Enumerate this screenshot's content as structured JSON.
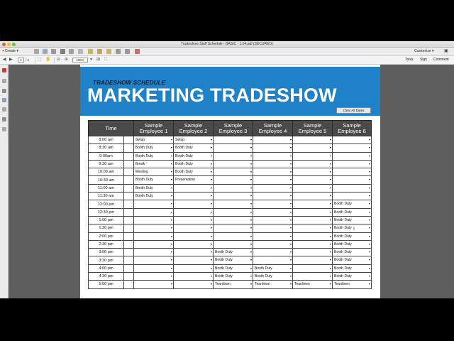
{
  "window": {
    "title": "Tradeshow Staff Schedule - BASIC - 1.04.pdf (SECURED)"
  },
  "toolbar": {
    "create_label": "Create",
    "customize_label": "Customize",
    "page_current": "1",
    "page_total": "/ 2",
    "zoom": "105%",
    "tools_label": "Tools",
    "sign_label": "Sign",
    "comment_label": "Comment"
  },
  "document": {
    "subtitle": "TRADESHOW SCHEDULE",
    "title": "MARKETING TRADESHOW",
    "clear_button": "Clear All Dates",
    "table": {
      "time_header": "Time",
      "employee_headers": [
        "Sample Employee 1",
        "Sample Employee 2",
        "Sample Employee 3",
        "Sample Employee 4",
        "Sample Employee 5",
        "Sample Employee 6"
      ],
      "rows": [
        {
          "time": "8:00 am",
          "cells": [
            "Setup",
            "Setup",
            "",
            "",
            "",
            ""
          ]
        },
        {
          "time": "8:30 am",
          "cells": [
            "Booth Duty",
            "Booth Duty",
            "",
            "",
            "",
            ""
          ]
        },
        {
          "time": "9:00am",
          "cells": [
            "Booth Duty",
            "Booth Duty",
            "",
            "",
            "",
            ""
          ]
        },
        {
          "time": "9:30 am",
          "cells": [
            "Break",
            "Booth Duty",
            "",
            "",
            "",
            ""
          ]
        },
        {
          "time": "10:00 am",
          "cells": [
            "Meeting",
            "Booth Duty",
            "",
            "",
            "",
            ""
          ]
        },
        {
          "time": "10:30 am",
          "cells": [
            "Booth Duty",
            "Presentation",
            "",
            "",
            "",
            ""
          ]
        },
        {
          "time": "11:00 am",
          "cells": [
            "Booth Duty",
            "",
            "",
            "",
            "",
            ""
          ]
        },
        {
          "time": "11:30 am",
          "cells": [
            "Booth Duty",
            "",
            "",
            "",
            "",
            ""
          ]
        },
        {
          "time": "12:00 pm",
          "cells": [
            "",
            "",
            "",
            "",
            "",
            "Booth Duty"
          ]
        },
        {
          "time": "12:30 pm",
          "cells": [
            "",
            "",
            "",
            "",
            "",
            "Booth Duty"
          ]
        },
        {
          "time": "1:00 pm",
          "cells": [
            "",
            "",
            "",
            "",
            "",
            "Booth Duty"
          ]
        },
        {
          "time": "1:30 pm",
          "cells": [
            "",
            "",
            "",
            "",
            "",
            "Booth Duty"
          ]
        },
        {
          "time": "2:00 pm",
          "cells": [
            "",
            "",
            "",
            "",
            "",
            "Booth Duty"
          ]
        },
        {
          "time": "2:30 pm",
          "cells": [
            "",
            "",
            "",
            "",
            "",
            "Booth Duty"
          ]
        },
        {
          "time": "3:00 pm",
          "cells": [
            "",
            "",
            "Booth Duty",
            "",
            "",
            "Booth Duty"
          ]
        },
        {
          "time": "3:30 pm",
          "cells": [
            "",
            "",
            "Booth Duty",
            "",
            "",
            "Booth Duty"
          ]
        },
        {
          "time": "4:00 pm",
          "cells": [
            "",
            "",
            "Booth Duty",
            "Booth Duty",
            "",
            "Booth Duty"
          ]
        },
        {
          "time": "4:30 pm",
          "cells": [
            "",
            "",
            "Booth Duty",
            "Booth Duty",
            "",
            "Booth Duty"
          ]
        },
        {
          "time": "5:00 pm",
          "cells": [
            "",
            "",
            "Teardown",
            "Teardown",
            "Teardown",
            "Teardown"
          ]
        }
      ]
    }
  },
  "colors": {
    "banner": "#1f82c9",
    "header_bg": "#4a4a4a",
    "viewer_bg": "#5e5e5e"
  },
  "icons": [
    "close-icon",
    "minimize-icon",
    "zoom-icon",
    "save-icon",
    "print-icon",
    "mail-icon",
    "previous-page-icon",
    "next-page-icon",
    "select-icon",
    "hand-icon",
    "zoom-out-icon",
    "zoom-in-icon",
    "fit-page-icon",
    "fullscreen-icon"
  ]
}
